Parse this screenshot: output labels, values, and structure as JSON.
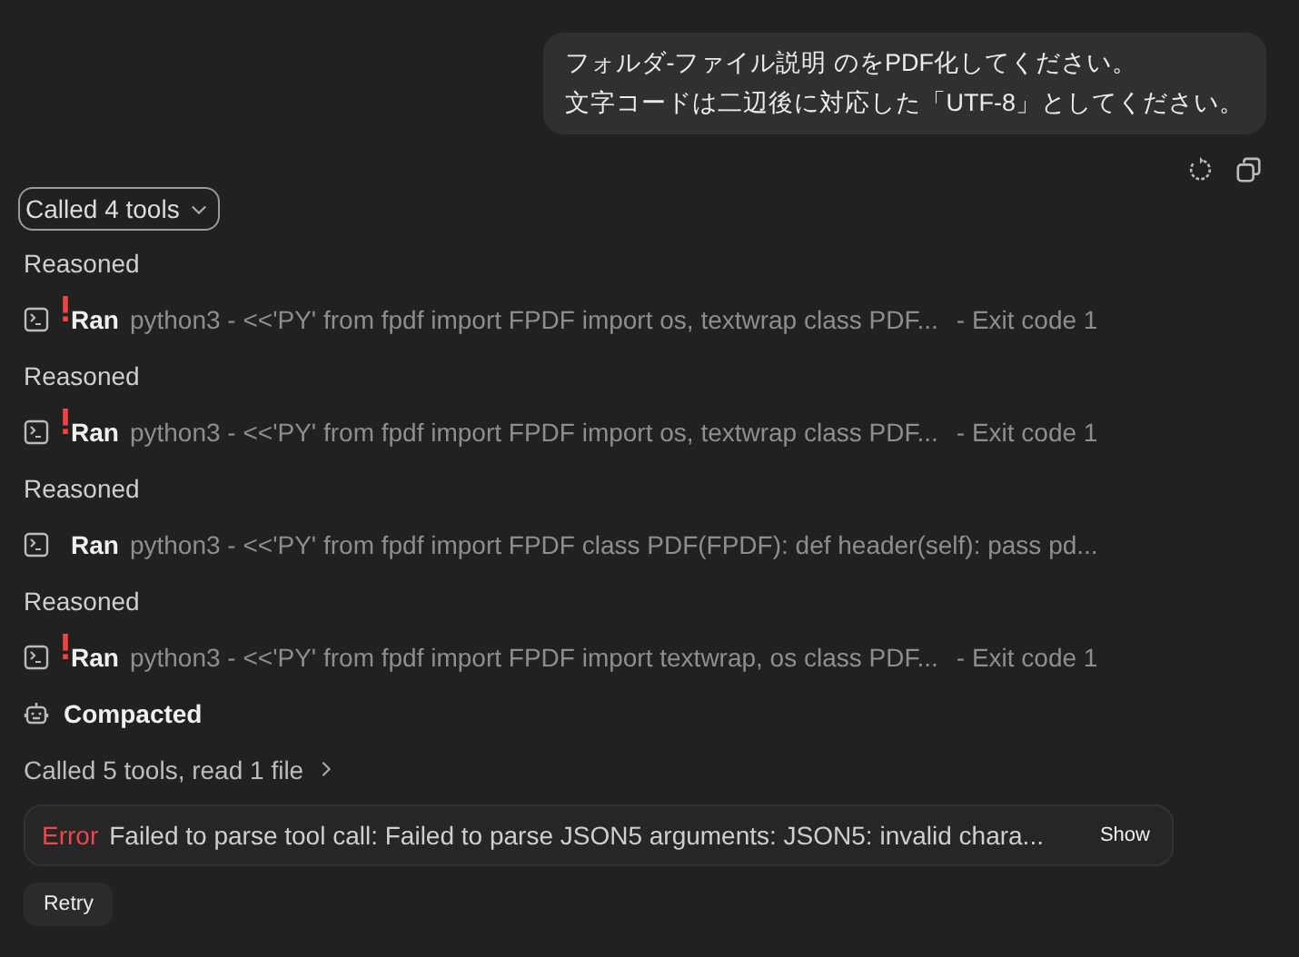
{
  "message": {
    "lines": [
      "フォルダ-ファイル説明 のをPDF化してください。",
      "文字コードは二辺後に対応した「UTF-8」としてください。"
    ]
  },
  "tool_group": {
    "label": "Called 4 tools",
    "expanded": true
  },
  "steps": [
    {
      "kind": "reasoned",
      "label": "Reasoned"
    },
    {
      "kind": "ran",
      "label": "Ran",
      "error": true,
      "command": "python3 - <<'PY' from fpdf import FPDF import os, textwrap class PDF...",
      "result": "- Exit code 1"
    },
    {
      "kind": "reasoned",
      "label": "Reasoned"
    },
    {
      "kind": "ran",
      "label": "Ran",
      "error": true,
      "command": "python3 - <<'PY' from fpdf import FPDF import os, textwrap class PDF...",
      "result": "- Exit code 1"
    },
    {
      "kind": "reasoned",
      "label": "Reasoned"
    },
    {
      "kind": "ran",
      "label": "Ran",
      "error": false,
      "command": "python3 - <<'PY' from fpdf import FPDF class PDF(FPDF): def header(self): pass pd..."
    },
    {
      "kind": "reasoned",
      "label": "Reasoned"
    },
    {
      "kind": "ran",
      "label": "Ran",
      "error": true,
      "command": "python3 - <<'PY' from fpdf import FPDF import textwrap, os class PDF...",
      "result": "- Exit code 1"
    },
    {
      "kind": "compacted",
      "label": "Compacted"
    }
  ],
  "summary": {
    "label": "Called 5 tools, read 1 file",
    "expanded": false
  },
  "error_banner": {
    "label": "Error",
    "message": "Failed to parse tool call: Failed to parse JSON5 arguments: JSON5: invalid chara...",
    "action": "Show"
  },
  "retry": {
    "label": "Retry"
  }
}
